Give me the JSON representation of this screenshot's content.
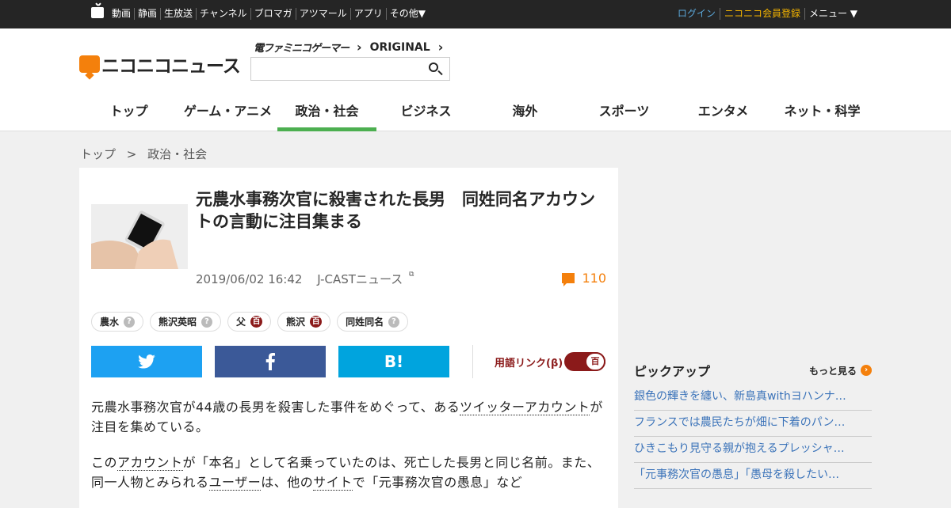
{
  "topbar": {
    "nav": [
      "動画",
      "静画",
      "生放送",
      "チャンネル",
      "ブロマガ",
      "アツマール",
      "アプリ",
      "その他▼"
    ],
    "login": "ログイン",
    "register": "ニコニコ会員登録",
    "menu": "メニュー ▼",
    "colors": {
      "login": "#5ba7d9",
      "register": "#f4b400"
    }
  },
  "header": {
    "logo_text": "ニコニコニュース",
    "partner1": "電ファミニコゲーマー",
    "partner2": "ORIGINAL",
    "search_placeholder": ""
  },
  "catnav": {
    "items": [
      "トップ",
      "ゲーム・アニメ",
      "政治・社会",
      "ビジネス",
      "海外",
      "スポーツ",
      "エンタメ",
      "ネット・科学"
    ],
    "active_index": 2
  },
  "breadcrumb": {
    "home": "トップ",
    "sep": ">",
    "current": "政治・社会"
  },
  "article": {
    "title": "元農水事務次官に殺害された長男　同姓同名アカウントの言動に注目集まる",
    "datetime": "2019/06/02 16:42",
    "source": "J-CASTニュース",
    "comment_count": "110",
    "tags": [
      {
        "label": "農水",
        "icon": "q"
      },
      {
        "label": "熊沢英昭",
        "icon": "q"
      },
      {
        "label": "父",
        "icon": "d"
      },
      {
        "label": "熊沢",
        "icon": "d"
      },
      {
        "label": "同姓同名",
        "icon": "q"
      }
    ],
    "share": {
      "twitter_icon": "twitter-icon",
      "facebook_icon": "facebook-icon",
      "hatena": "B!"
    },
    "yougo_label": "用語リンク(β)",
    "yougo_icon": "百",
    "p1_a": "元農水事務次官が44歳の長男を殺害した事件をめぐって、ある",
    "p1_link": "ツイッターアカウント",
    "p1_b": "が注目を集めている。",
    "p2_a": "この",
    "p2_link1": "アカウント",
    "p2_b": "が「本名」として名乗っていたのは、死亡した長男と同じ名前。また、同一人物とみられる",
    "p2_link2": "ユーザー",
    "p2_c": "は、他の",
    "p2_link3": "サイト",
    "p2_d": "で「元事務次官の愚息」など"
  },
  "pickup": {
    "title": "ピックアップ",
    "more": "もっと見る",
    "items": [
      "銀色の輝きを纏い、新島真withヨハンナ…",
      "フランスでは農民たちが畑に下着のパン…",
      "ひきこもり見守る親が抱えるプレッシャ…",
      "「元事務次官の愚息」「愚母を殺したい…"
    ]
  }
}
